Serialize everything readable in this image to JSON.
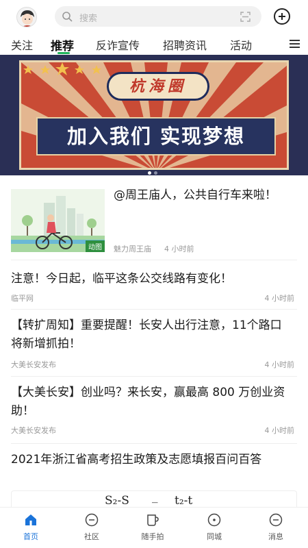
{
  "header": {
    "search_placeholder": "搜索"
  },
  "tabs": [
    {
      "label": "关注"
    },
    {
      "label": "推荐"
    },
    {
      "label": "反诈宣传"
    },
    {
      "label": "招聘资讯"
    },
    {
      "label": "活动"
    }
  ],
  "active_tab": 1,
  "banner": {
    "seal_text": "杭海圈",
    "slogan": "加入我们 实现梦想",
    "slide_index": 1,
    "slide_count": 2
  },
  "feed": [
    {
      "title": "@周王庙人，公共自行车来啦！",
      "source": "魅力周王庙",
      "time": "4 小时前",
      "thumb_tag": "动图"
    },
    {
      "title": "注意！今日起，临平这条公交线路有变化！",
      "source": "临平网",
      "time": "4 小时前"
    },
    {
      "title": "【转扩周知】重要提醒！长安人出行注意，11个路口将新增抓拍！",
      "source": "大美长安发布",
      "time": "4 小时前"
    },
    {
      "title": "【大美长安】创业吗？来长安，赢最高 800 万创业资助！",
      "source": "大美长安发布",
      "time": "4 小时前"
    },
    {
      "title": "2021年浙江省高考招生政策及志愿填报百问百答"
    }
  ],
  "formula": {
    "left": "S₂-S",
    "middle": "_",
    "right": "t₂-t"
  },
  "bottom_nav": [
    {
      "label": "首页",
      "icon": "home-icon"
    },
    {
      "label": "社区",
      "icon": "community-icon"
    },
    {
      "label": "随手拍",
      "icon": "camera-cup-icon"
    },
    {
      "label": "同城",
      "icon": "location-icon"
    },
    {
      "label": "消息",
      "icon": "message-icon"
    }
  ],
  "colors": {
    "accent_green": "#1eb45a",
    "nav_active": "#1a73d9",
    "banner_red": "#c94b35",
    "banner_navy": "#27335f"
  }
}
